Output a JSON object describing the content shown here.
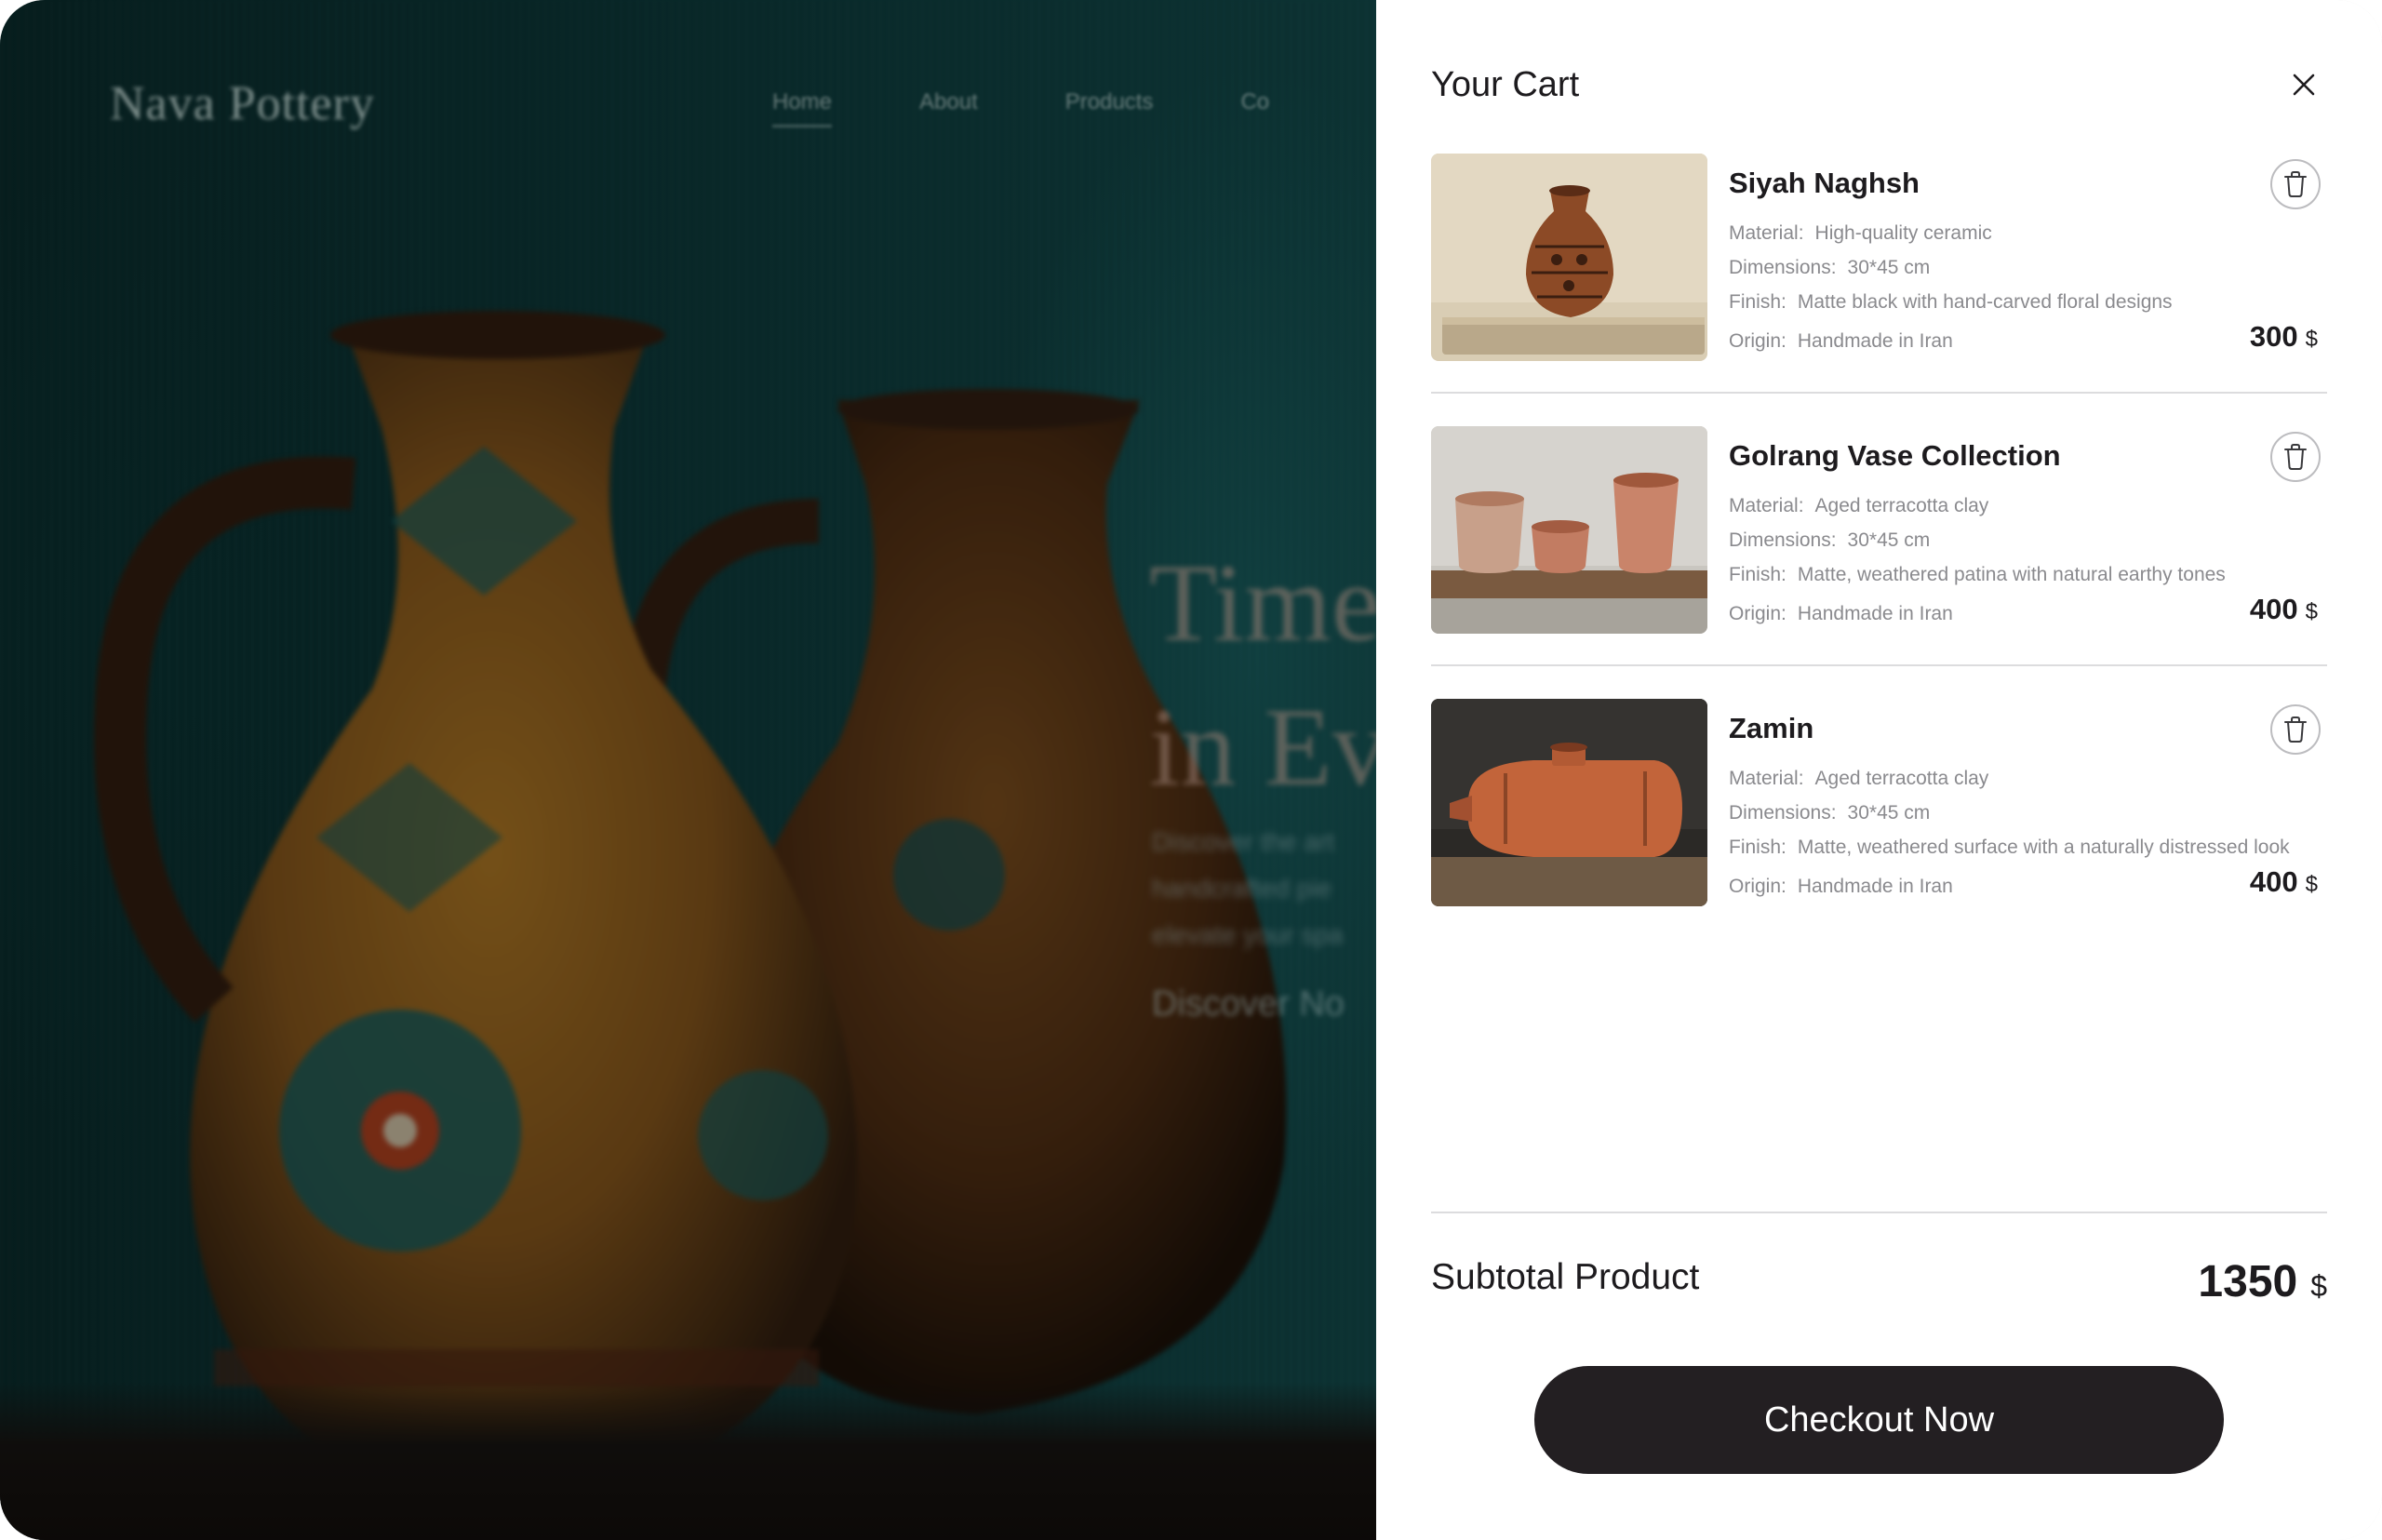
{
  "background": {
    "logo": "Nava Pottery",
    "nav": [
      "Home",
      "About",
      "Products",
      "Co"
    ],
    "hero_title": [
      "Time",
      "in Ev"
    ],
    "hero_desc": [
      "Discover the art",
      "handcrafted pie",
      "elevate your spa"
    ],
    "hero_cta": "Discover No"
  },
  "cart": {
    "title": "Your Cart",
    "close_icon": "close-icon",
    "items": [
      {
        "name": "Siyah Naghsh",
        "material_label": "Material:",
        "material": "High-quality ceramic",
        "dimensions_label": "Dimensions:",
        "dimensions": "30*45 cm",
        "finish_label": "Finish:",
        "finish": "Matte black with hand-carved floral designs",
        "origin_label": "Origin:",
        "origin": "Handmade in Iran",
        "price": "300",
        "currency": "$"
      },
      {
        "name": "Golrang Vase Collection",
        "material_label": "Material:",
        "material": "Aged terracotta clay",
        "dimensions_label": "Dimensions:",
        "dimensions": "30*45 cm",
        "finish_label": "Finish:",
        "finish": "Matte, weathered patina with natural earthy tones",
        "origin_label": "Origin:",
        "origin": "Handmade in Iran",
        "price": "400",
        "currency": "$"
      },
      {
        "name": "Zamin",
        "material_label": "Material:",
        "material": "Aged terracotta clay",
        "dimensions_label": "Dimensions:",
        "dimensions": "30*45 cm",
        "finish_label": "Finish:",
        "finish": "Matte, weathered surface with a naturally distressed look",
        "origin_label": "Origin:",
        "origin": "Handmade in Iran",
        "price": "400",
        "currency": "$"
      }
    ],
    "subtotal_label": "Subtotal Product",
    "subtotal_value": "1350",
    "subtotal_currency": "$",
    "checkout_label": "Checkout Now"
  },
  "colors": {
    "button_dark": "#231f22",
    "text_primary": "#1d1b1e",
    "text_muted": "#8a8a8e",
    "backdrop_teal": "#124e4f"
  }
}
